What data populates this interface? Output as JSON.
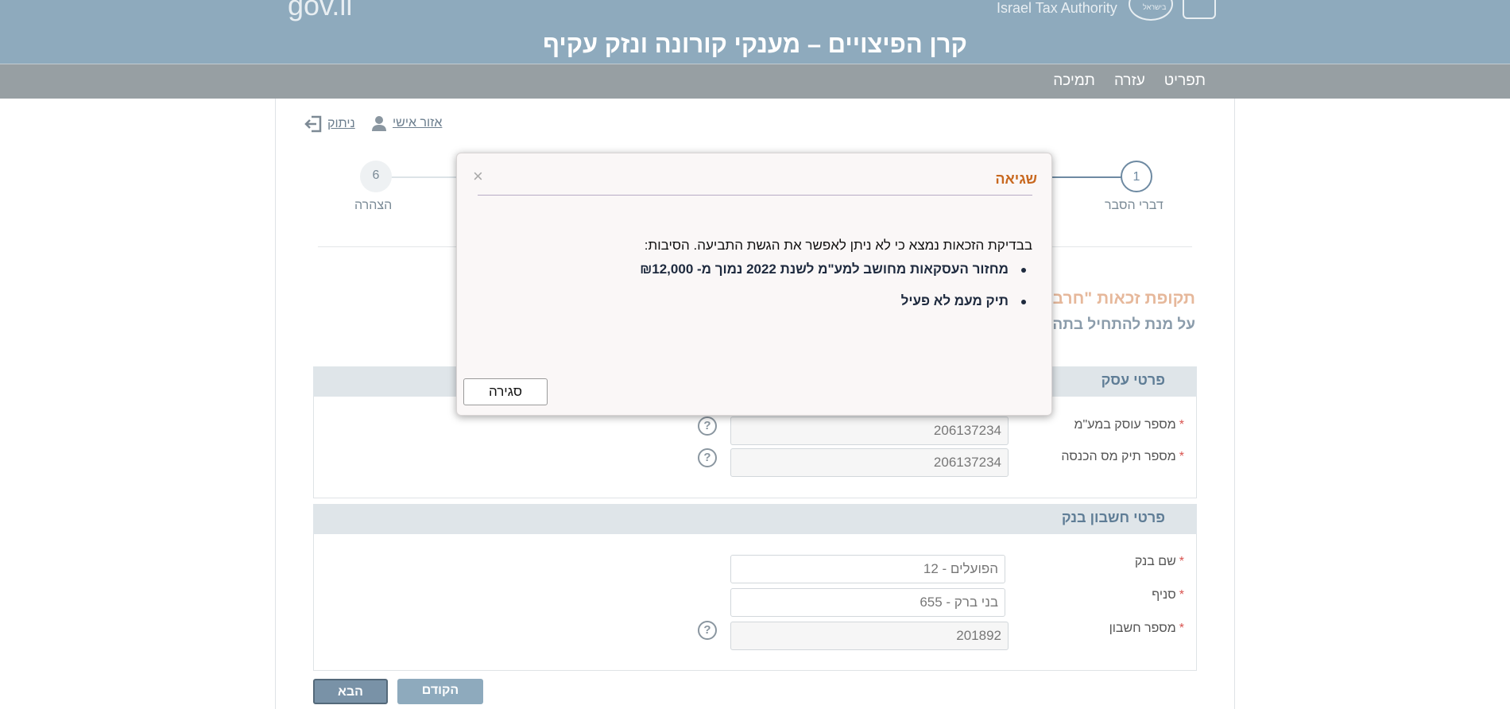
{
  "header": {
    "gov_text": "gov.il",
    "authority": "Israel Tax Authority",
    "seal_text": "בישראל",
    "title": "קרן הפיצויים – מענקי קורונה ונזק עקיף"
  },
  "nav": {
    "items": [
      "תפריט",
      "עזרה",
      "תמיכה"
    ]
  },
  "user_links": {
    "personal_area": "אזור אישי",
    "logout": "ניתוק"
  },
  "stepper": {
    "first": {
      "num": "1",
      "label": "דברי הסבר"
    },
    "last": {
      "num": "6",
      "label": "הצהרה"
    }
  },
  "period": {
    "title": "תקופת זכאות \"חרב",
    "subtitle": "על מנת להתחיל בתהלי"
  },
  "business": {
    "heading": "פרטי עסק",
    "vat_label": "מספר עוסק במע\"מ",
    "vat_value": "206137234",
    "tax_label": "מספר תיק מס הכנסה",
    "tax_value": "206137234"
  },
  "bank": {
    "heading": "פרטי חשבון בנק",
    "bank_label": "שם בנק",
    "bank_value": "הפועלים - 12",
    "branch_label": "סניף",
    "branch_value": "בני ברק - 655",
    "account_label": "מספר חשבון",
    "account_value": "201892"
  },
  "buttons": {
    "next": "הבא",
    "prev": "הקודם"
  },
  "help_glyph": "?",
  "required_mark": "*",
  "modal": {
    "title": "שגיאה",
    "close_glyph": "×",
    "intro": "בבדיקת הזכאות נמצא כי לא ניתן לאפשר את הגשת התביעה. הסיבות:",
    "reasons": [
      "מחזור העסקאות מחושב למע\"מ לשנת 2022 נמוך מ- ₪12,000",
      "תיק מעמ לא פעיל"
    ],
    "button": "סגירה"
  },
  "colors": {
    "header_bg": "#8eaabd",
    "nav_bg": "#979fa3",
    "modal_title": "#c8681f"
  }
}
